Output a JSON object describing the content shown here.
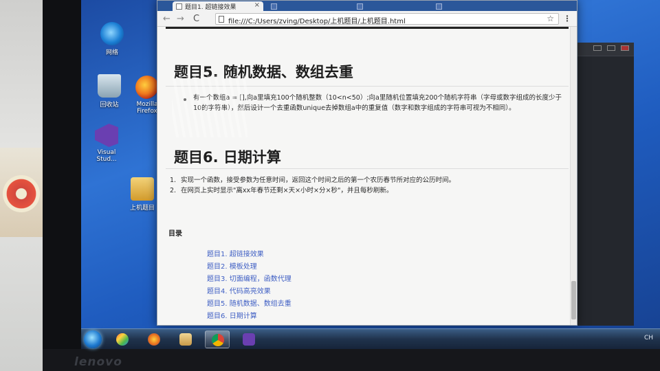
{
  "desktop": {
    "icons": [
      {
        "label": "网络"
      },
      {
        "label": "回收站"
      },
      {
        "label": "Mozilla Firefox"
      },
      {
        "label": "Visual Stud..."
      },
      {
        "label": "上机题目"
      }
    ]
  },
  "browser": {
    "active_tab_title": "题目1. 超链接效果",
    "tab_close": "×",
    "url": "file:///C:/Users/zving/Desktop/上机题目/上机题目.html",
    "bookmark_star": "☆",
    "menu_dots": "⋮",
    "back": "←",
    "forward": "→",
    "reload": "C"
  },
  "content": {
    "section5_title": "题目5. 随机数据、数组去重",
    "section5_text": "有一个数组a = [],向a里填充100个随机整数（10<n<50）;向a里随机位置填充200个随机字符串（字母或数字组成的长度少于10的字符串），然后设计一个去重函数unique去掉数组a中的重复值（数字和数字组成的字符串可视为不相同）。",
    "section6_title": "题目6. 日期计算",
    "section6_items": [
      "实现一个函数，接受参数为任意时间，返回这个时间之后的第一个农历春节所对应的公历时间。",
      "在网页上实时显示\"离xx年春节还剩×天×小时×分×秒\"，并且每秒刷新。"
    ],
    "toc_title": "目录",
    "toc": [
      "题目1. 超链接效果",
      "题目2. 模板处理",
      "题目3. 切面编程，函数代理",
      "题目4. 代码高亮效果",
      "题目5. 随机数据、数组去重",
      "题目6. 日期计算"
    ]
  },
  "monitor": {
    "brand": "lenovo"
  },
  "taskbar": {
    "tray_text": "CH"
  }
}
